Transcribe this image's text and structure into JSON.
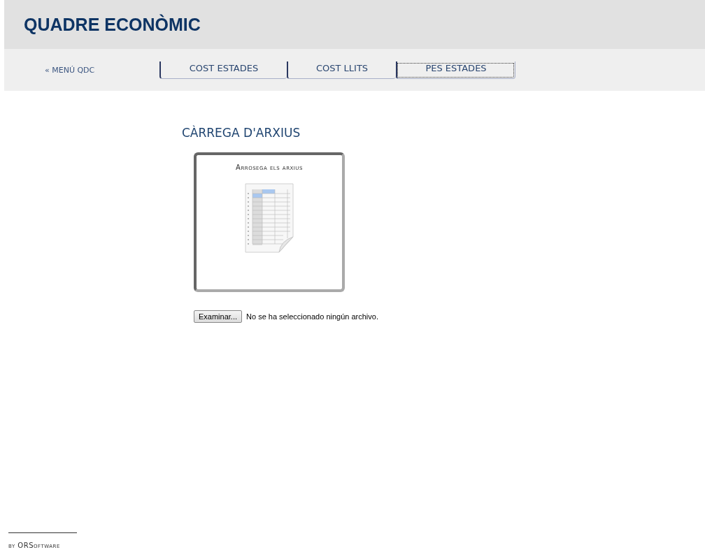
{
  "header": {
    "title": "QUADRE ECONÒMIC"
  },
  "nav": {
    "back_link": "« MENÚ QDC",
    "tabs": [
      {
        "label": "COST ESTADES",
        "selected": false
      },
      {
        "label": "COST LLITS",
        "selected": false
      },
      {
        "label": "PES ESTADES",
        "selected": true
      }
    ]
  },
  "upload": {
    "heading": "CÀRREGA D'ARXIUS",
    "drop_zone_label": "Arrosega els arxius",
    "browse_button": "Examinar...",
    "file_status": "No se ha seleccionado ningún archivo."
  },
  "footer": {
    "credit": "by ORSoftware"
  }
}
